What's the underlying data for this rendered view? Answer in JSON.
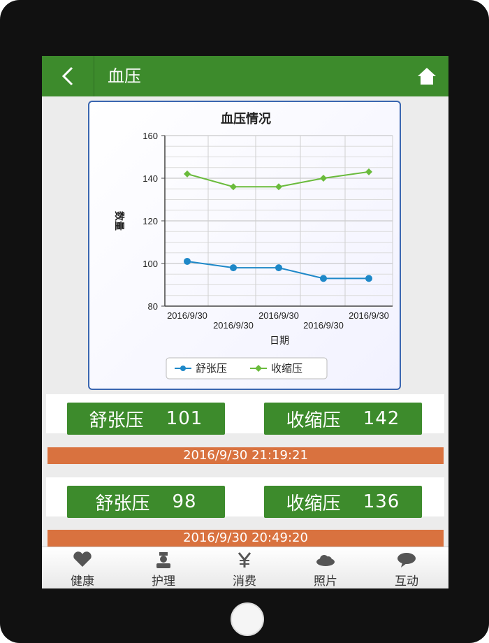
{
  "header": {
    "title": "血压",
    "back_icon": "back-arrow-icon",
    "home_icon": "home-icon"
  },
  "chart_data": {
    "type": "line",
    "title": "血压情况",
    "xlabel": "日期",
    "ylabel": "数量",
    "ylim": [
      80,
      160
    ],
    "yticks": [
      "160",
      "140",
      "120",
      "100",
      "80"
    ],
    "categories": [
      "2016/9/30",
      "2016/9/30",
      "2016/9/30",
      "2016/9/30",
      "2016/9/30"
    ],
    "series": [
      {
        "name": "舒张压",
        "color": "#1e88c8",
        "values": [
          101,
          98,
          98,
          93,
          93
        ]
      },
      {
        "name": "收缩压",
        "color": "#6abb3c",
        "values": [
          142,
          136,
          136,
          140,
          143
        ]
      }
    ],
    "legend_position": "bottom"
  },
  "readings": [
    {
      "diastolic_label": "舒张压",
      "diastolic": "101",
      "systolic_label": "收缩压",
      "systolic": "142",
      "time": "2016/9/30 21:19:21"
    },
    {
      "diastolic_label": "舒张压",
      "diastolic": "98",
      "systolic_label": "收缩压",
      "systolic": "136",
      "time": "2016/9/30 20:49:20"
    }
  ],
  "tabbar": {
    "items": [
      {
        "label": "健康",
        "icon": "heart-icon"
      },
      {
        "label": "护理",
        "icon": "nurse-icon"
      },
      {
        "label": "消费",
        "icon": "yen-icon"
      },
      {
        "label": "照片",
        "icon": "cloud-icon"
      },
      {
        "label": "互动",
        "icon": "chat-bubble-icon"
      }
    ]
  },
  "colors": {
    "primary": "#3d8b2c",
    "accent": "#d9723f",
    "chart_border": "#3a66b0"
  }
}
